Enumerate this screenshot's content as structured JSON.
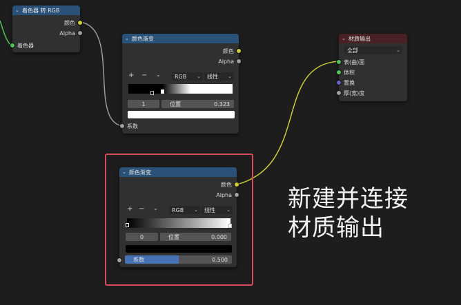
{
  "node_shader_to_rgb": {
    "title": "着色器 转 RGB",
    "outputs": [
      "颜色",
      "Alpha"
    ],
    "input": "着色器"
  },
  "node_ramp1": {
    "title": "颜色渐变",
    "outputs": [
      "颜色",
      "Alpha"
    ],
    "add": "+",
    "remove": "−",
    "menu": "⌄",
    "color_mode": "RGB",
    "interpolation": "线性",
    "index": "1",
    "pos_label": "位置",
    "pos_value": "0.323",
    "factor": "系数"
  },
  "node_output": {
    "title": "材质输出",
    "target": "全部",
    "inputs": [
      "表(曲)面",
      "体积",
      "置换",
      "厚(宽)度"
    ]
  },
  "node_ramp2": {
    "title": "颜色渐变",
    "outputs": [
      "颜色",
      "Alpha"
    ],
    "add": "+",
    "remove": "−",
    "menu": "⌄",
    "color_mode": "RGB",
    "interpolation": "线性",
    "index": "0",
    "pos_label": "位置",
    "pos_value": "0.000",
    "factor_label": "系数",
    "factor_value": "0.500",
    "factor_fill": 0.5
  },
  "caption": [
    "新建并连接",
    "材质输出"
  ],
  "colors": {
    "socket_color": "#cdcc3a",
    "socket_float": "#a1a1a1",
    "socket_shader": "#52c35a",
    "socket_vector": "#6363c7",
    "highlight": "#d84b5a"
  }
}
